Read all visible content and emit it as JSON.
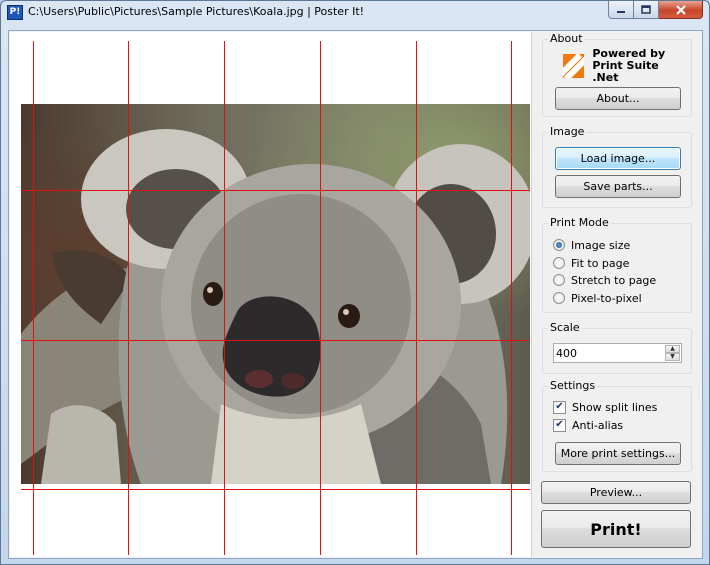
{
  "window": {
    "title": "C:\\Users\\Public\\Pictures\\Sample Pictures\\Koala.jpg | Poster It!",
    "app_icon_text": "P!"
  },
  "about": {
    "title": "About",
    "logo_line1": "Powered by",
    "logo_line2": "Print Suite .Net",
    "about_button": "About..."
  },
  "image": {
    "title": "Image",
    "load_button": "Load image...",
    "save_button": "Save parts..."
  },
  "print_mode": {
    "title": "Print Mode",
    "options": [
      "Image size",
      "Fit to page",
      "Stretch to page",
      "Pixel-to-pixel"
    ],
    "selected": "Image size"
  },
  "scale": {
    "title": "Scale",
    "value": "400"
  },
  "settings": {
    "title": "Settings",
    "show_split_lines": "Show split lines",
    "show_split_lines_checked": true,
    "anti_alias": "Anti-alias",
    "anti_alias_checked": true,
    "more_button": "More print settings..."
  },
  "actions": {
    "preview_button": "Preview...",
    "print_button": "Print!"
  },
  "colors": {
    "split_line": "#e01010",
    "logo_accent": "#f07a10"
  }
}
